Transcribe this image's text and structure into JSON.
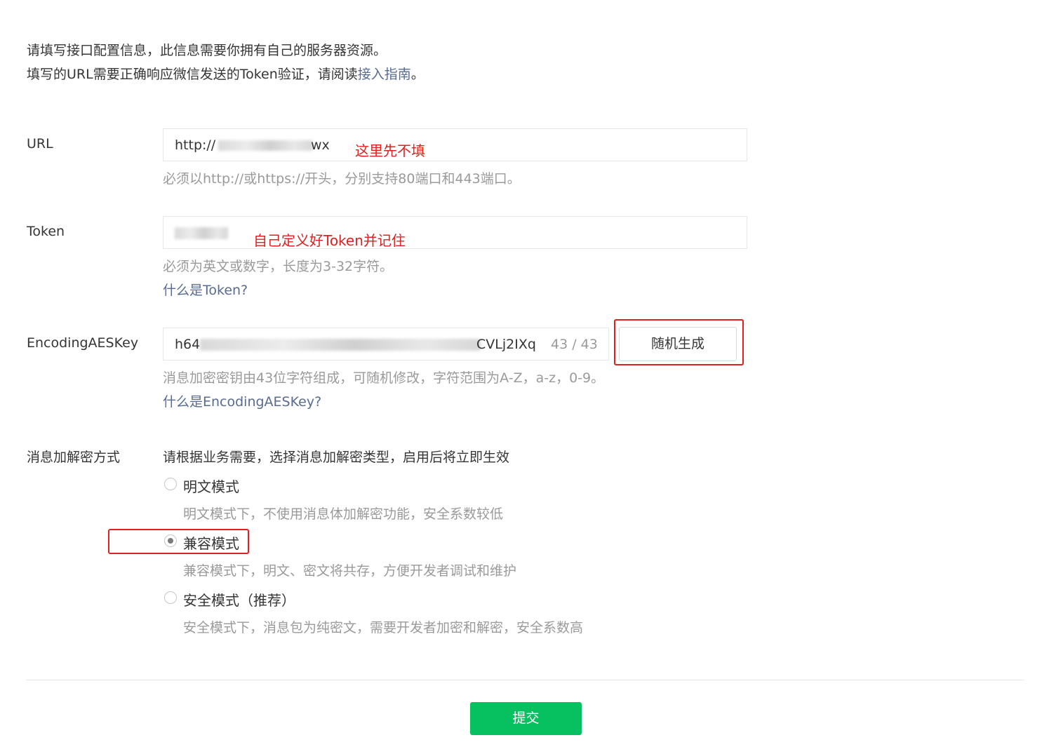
{
  "intro": {
    "line1": "请填写接口配置信息，此信息需要你拥有自己的服务器资源。",
    "line2_prefix": "填写的URL需要正确响应微信发送的Token验证，请阅读",
    "line2_link": "接入指南",
    "line2_suffix": "。"
  },
  "url": {
    "label": "URL",
    "value_start": "http://",
    "value_end": "wx",
    "annotation": "这里先不填",
    "hint": "必须以http://或https://开头，分别支持80端口和443端口。"
  },
  "token": {
    "label": "Token",
    "annotation": "自己定义好Token并记住",
    "hint": "必须为英文或数字，长度为3-32字符。",
    "help_link": "什么是Token?"
  },
  "aeskey": {
    "label": "EncodingAESKey",
    "value_start": "h64",
    "value_end": "CVLj2IXq",
    "count": "43 / 43",
    "generate_button": "随机生成",
    "hint": "消息加密密钥由43位字符组成，可随机修改，字符范围为A-Z，a-z，0-9。",
    "help_link": "什么是EncodingAESKey?"
  },
  "encryption": {
    "label": "消息加解密方式",
    "description": "请根据业务需要，选择消息加解密类型，启用后将立即生效",
    "options": [
      {
        "label": "明文模式",
        "desc": "明文模式下，不使用消息体加解密功能，安全系数较低",
        "checked": false
      },
      {
        "label": "兼容模式",
        "desc": "兼容模式下，明文、密文将共存，方便开发者调试和维护",
        "checked": true
      },
      {
        "label": "安全模式（推荐）",
        "desc": "安全模式下，消息包为纯密文，需要开发者加密和解密，安全系数高",
        "checked": false
      }
    ]
  },
  "submit_label": "提交",
  "colors": {
    "primary": "#07c160",
    "link": "#576b95",
    "annotation": "#e02020",
    "hint": "#9a9a9a"
  }
}
